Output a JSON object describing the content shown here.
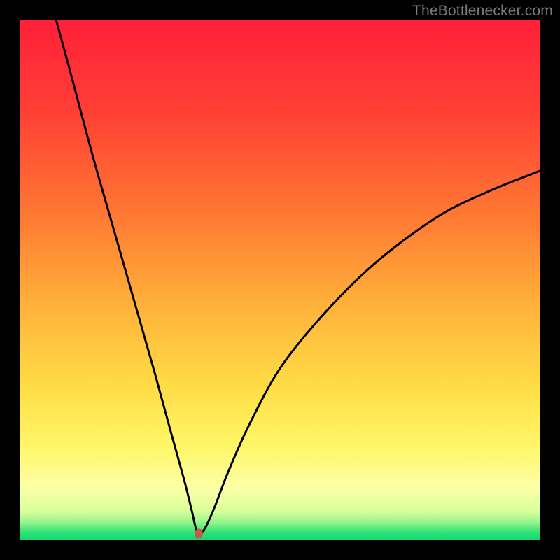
{
  "watermark": "TheBottlenecker.com",
  "colors": {
    "frame": "#000000",
    "curve": "#000000",
    "marker": "#c45a4d",
    "gradient_stops": [
      {
        "offset": 0.0,
        "color": "#ff1f3a"
      },
      {
        "offset": 0.18,
        "color": "#ff4034"
      },
      {
        "offset": 0.38,
        "color": "#ff7a33"
      },
      {
        "offset": 0.55,
        "color": "#ffb23a"
      },
      {
        "offset": 0.7,
        "color": "#ffdb45"
      },
      {
        "offset": 0.82,
        "color": "#fff769"
      },
      {
        "offset": 0.9,
        "color": "#fdffa6"
      },
      {
        "offset": 0.945,
        "color": "#d7ff9a"
      },
      {
        "offset": 0.965,
        "color": "#96f58a"
      },
      {
        "offset": 0.985,
        "color": "#2fe27a"
      },
      {
        "offset": 1.0,
        "color": "#14d66e"
      }
    ]
  },
  "chart_data": {
    "type": "line",
    "title": "",
    "xlabel": "",
    "ylabel": "",
    "xlim": [
      0,
      100
    ],
    "ylim": [
      0,
      100
    ],
    "grid": false,
    "legend": false,
    "marker": {
      "x": 34.4,
      "y": 1.3
    },
    "series": [
      {
        "name": "bottleneck-curve",
        "x": [
          7,
          10,
          14,
          18,
          22,
          26,
          29,
          31.5,
          33,
          33.8,
          34.4,
          35.6,
          37.5,
          40,
          44,
          50,
          58,
          68,
          80,
          90,
          100
        ],
        "y": [
          100,
          89,
          74,
          60,
          46,
          32,
          21,
          12,
          6,
          2.5,
          1.3,
          2.3,
          6.5,
          13,
          22,
          33,
          43,
          53,
          62,
          67,
          71
        ]
      }
    ]
  }
}
